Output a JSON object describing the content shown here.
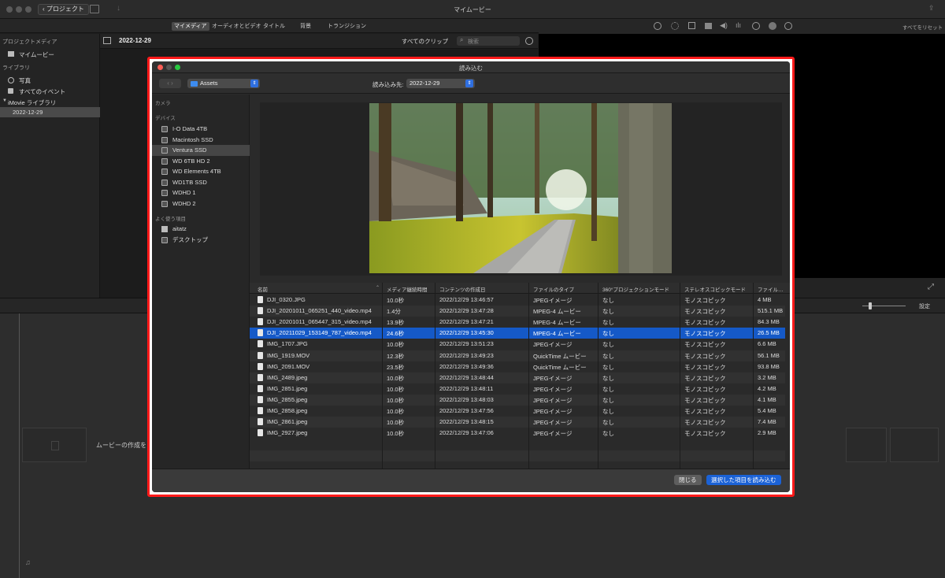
{
  "app": {
    "title": "マイムービー",
    "project_button": "プロジェクト"
  },
  "toolbar": {
    "tabs": [
      "マイメディア",
      "オーディオとビデオ",
      "タイトル",
      "背景",
      "トランジション"
    ],
    "reset_label": "すべてをリセット"
  },
  "library": {
    "project_media_header": "プロジェクトメディア",
    "my_movie": "マイムービー",
    "library_header": "ライブラリ",
    "photos": "写真",
    "all_events": "すべてのイベント",
    "imovie_library": "iMovie ライブラリ",
    "event": "2022-12-29"
  },
  "browser": {
    "event_title": "2022-12-29",
    "filter": "すべてのクリップ",
    "search_placeholder": "検索"
  },
  "timeline": {
    "settings_label": "設定",
    "create_movie_text": "ムービーの作成を"
  },
  "dialog": {
    "title": "読み込む",
    "location": "Assets",
    "import_to_label": "読み込み先:",
    "import_to_value": "2022-12-29",
    "sidebar": {
      "camera_header": "カメラ",
      "devices_header": "デバイス",
      "devices": [
        "I-O Data 4TB",
        "Macintosh SSD",
        "Ventura SSD",
        "WD 6TB HD 2",
        "WD Elements 4TB",
        "WD1TB SSD",
        "WDHD 1",
        "WDHD 2"
      ],
      "selected_device_index": 2,
      "favorites_header": "よく使う項目",
      "favorites": [
        "aitatz",
        "デスクトップ"
      ]
    },
    "columns": [
      "名前",
      "メディア継続時間",
      "コンテンツの作成日",
      "ファイルのタイプ",
      "360°プロジェクションモード",
      "ステレオスコピックモード",
      "ファイル…"
    ],
    "files": [
      {
        "name": "DJI_0320.JPG",
        "duration": "10.0秒",
        "created": "2022/12/29 13:46:57",
        "type": "JPEGイメージ",
        "projection": "なし",
        "stereo": "モノスコピック",
        "size": "4 MB"
      },
      {
        "name": "DJI_20201011_065251_440_video.mp4",
        "duration": "1.4分",
        "created": "2022/12/29 13:47:28",
        "type": "MPEG-4 ムービー",
        "projection": "なし",
        "stereo": "モノスコピック",
        "size": "515.1 MB"
      },
      {
        "name": "DJI_20201011_065447_315_video.mp4",
        "duration": "13.9秒",
        "created": "2022/12/29 13:47:21",
        "type": "MPEG-4 ムービー",
        "projection": "なし",
        "stereo": "モノスコピック",
        "size": "84.3 MB"
      },
      {
        "name": "DJI_20211029_153149_787_video.mp4",
        "duration": "24.6秒",
        "created": "2022/12/29 13:45:30",
        "type": "MPEG-4 ムービー",
        "projection": "なし",
        "stereo": "モノスコピック",
        "size": "26.5 MB"
      },
      {
        "name": "IMG_1707.JPG",
        "duration": "10.0秒",
        "created": "2022/12/29 13:51:23",
        "type": "JPEGイメージ",
        "projection": "なし",
        "stereo": "モノスコピック",
        "size": "6.6 MB"
      },
      {
        "name": "IMG_1919.MOV",
        "duration": "12.3秒",
        "created": "2022/12/29 13:49:23",
        "type": "QuickTime ムービー",
        "projection": "なし",
        "stereo": "モノスコピック",
        "size": "56.1 MB"
      },
      {
        "name": "IMG_2091.MOV",
        "duration": "23.5秒",
        "created": "2022/12/29 13:49:36",
        "type": "QuickTime ムービー",
        "projection": "なし",
        "stereo": "モノスコピック",
        "size": "93.8 MB"
      },
      {
        "name": "IMG_2489.jpeg",
        "duration": "10.0秒",
        "created": "2022/12/29 13:48:44",
        "type": "JPEGイメージ",
        "projection": "なし",
        "stereo": "モノスコピック",
        "size": "3.2 MB"
      },
      {
        "name": "IMG_2851.jpeg",
        "duration": "10.0秒",
        "created": "2022/12/29 13:48:11",
        "type": "JPEGイメージ",
        "projection": "なし",
        "stereo": "モノスコピック",
        "size": "4.2 MB"
      },
      {
        "name": "IMG_2855.jpeg",
        "duration": "10.0秒",
        "created": "2022/12/29 13:48:03",
        "type": "JPEGイメージ",
        "projection": "なし",
        "stereo": "モノスコピック",
        "size": "4.1 MB"
      },
      {
        "name": "IMG_2858.jpeg",
        "duration": "10.0秒",
        "created": "2022/12/29 13:47:56",
        "type": "JPEGイメージ",
        "projection": "なし",
        "stereo": "モノスコピック",
        "size": "5.4 MB"
      },
      {
        "name": "IMG_2861.jpeg",
        "duration": "10.0秒",
        "created": "2022/12/29 13:48:15",
        "type": "JPEGイメージ",
        "projection": "なし",
        "stereo": "モノスコピック",
        "size": "7.4 MB"
      },
      {
        "name": "IMG_2927.jpeg",
        "duration": "10.0秒",
        "created": "2022/12/29 13:47:06",
        "type": "JPEGイメージ",
        "projection": "なし",
        "stereo": "モノスコピック",
        "size": "2.9 MB"
      }
    ],
    "selected_file_index": 3,
    "close_button": "閉じる",
    "import_button": "選択した項目を読み込む"
  },
  "colors": {
    "accent": "#1559c7",
    "highlight_border": "#ff1a1a"
  }
}
